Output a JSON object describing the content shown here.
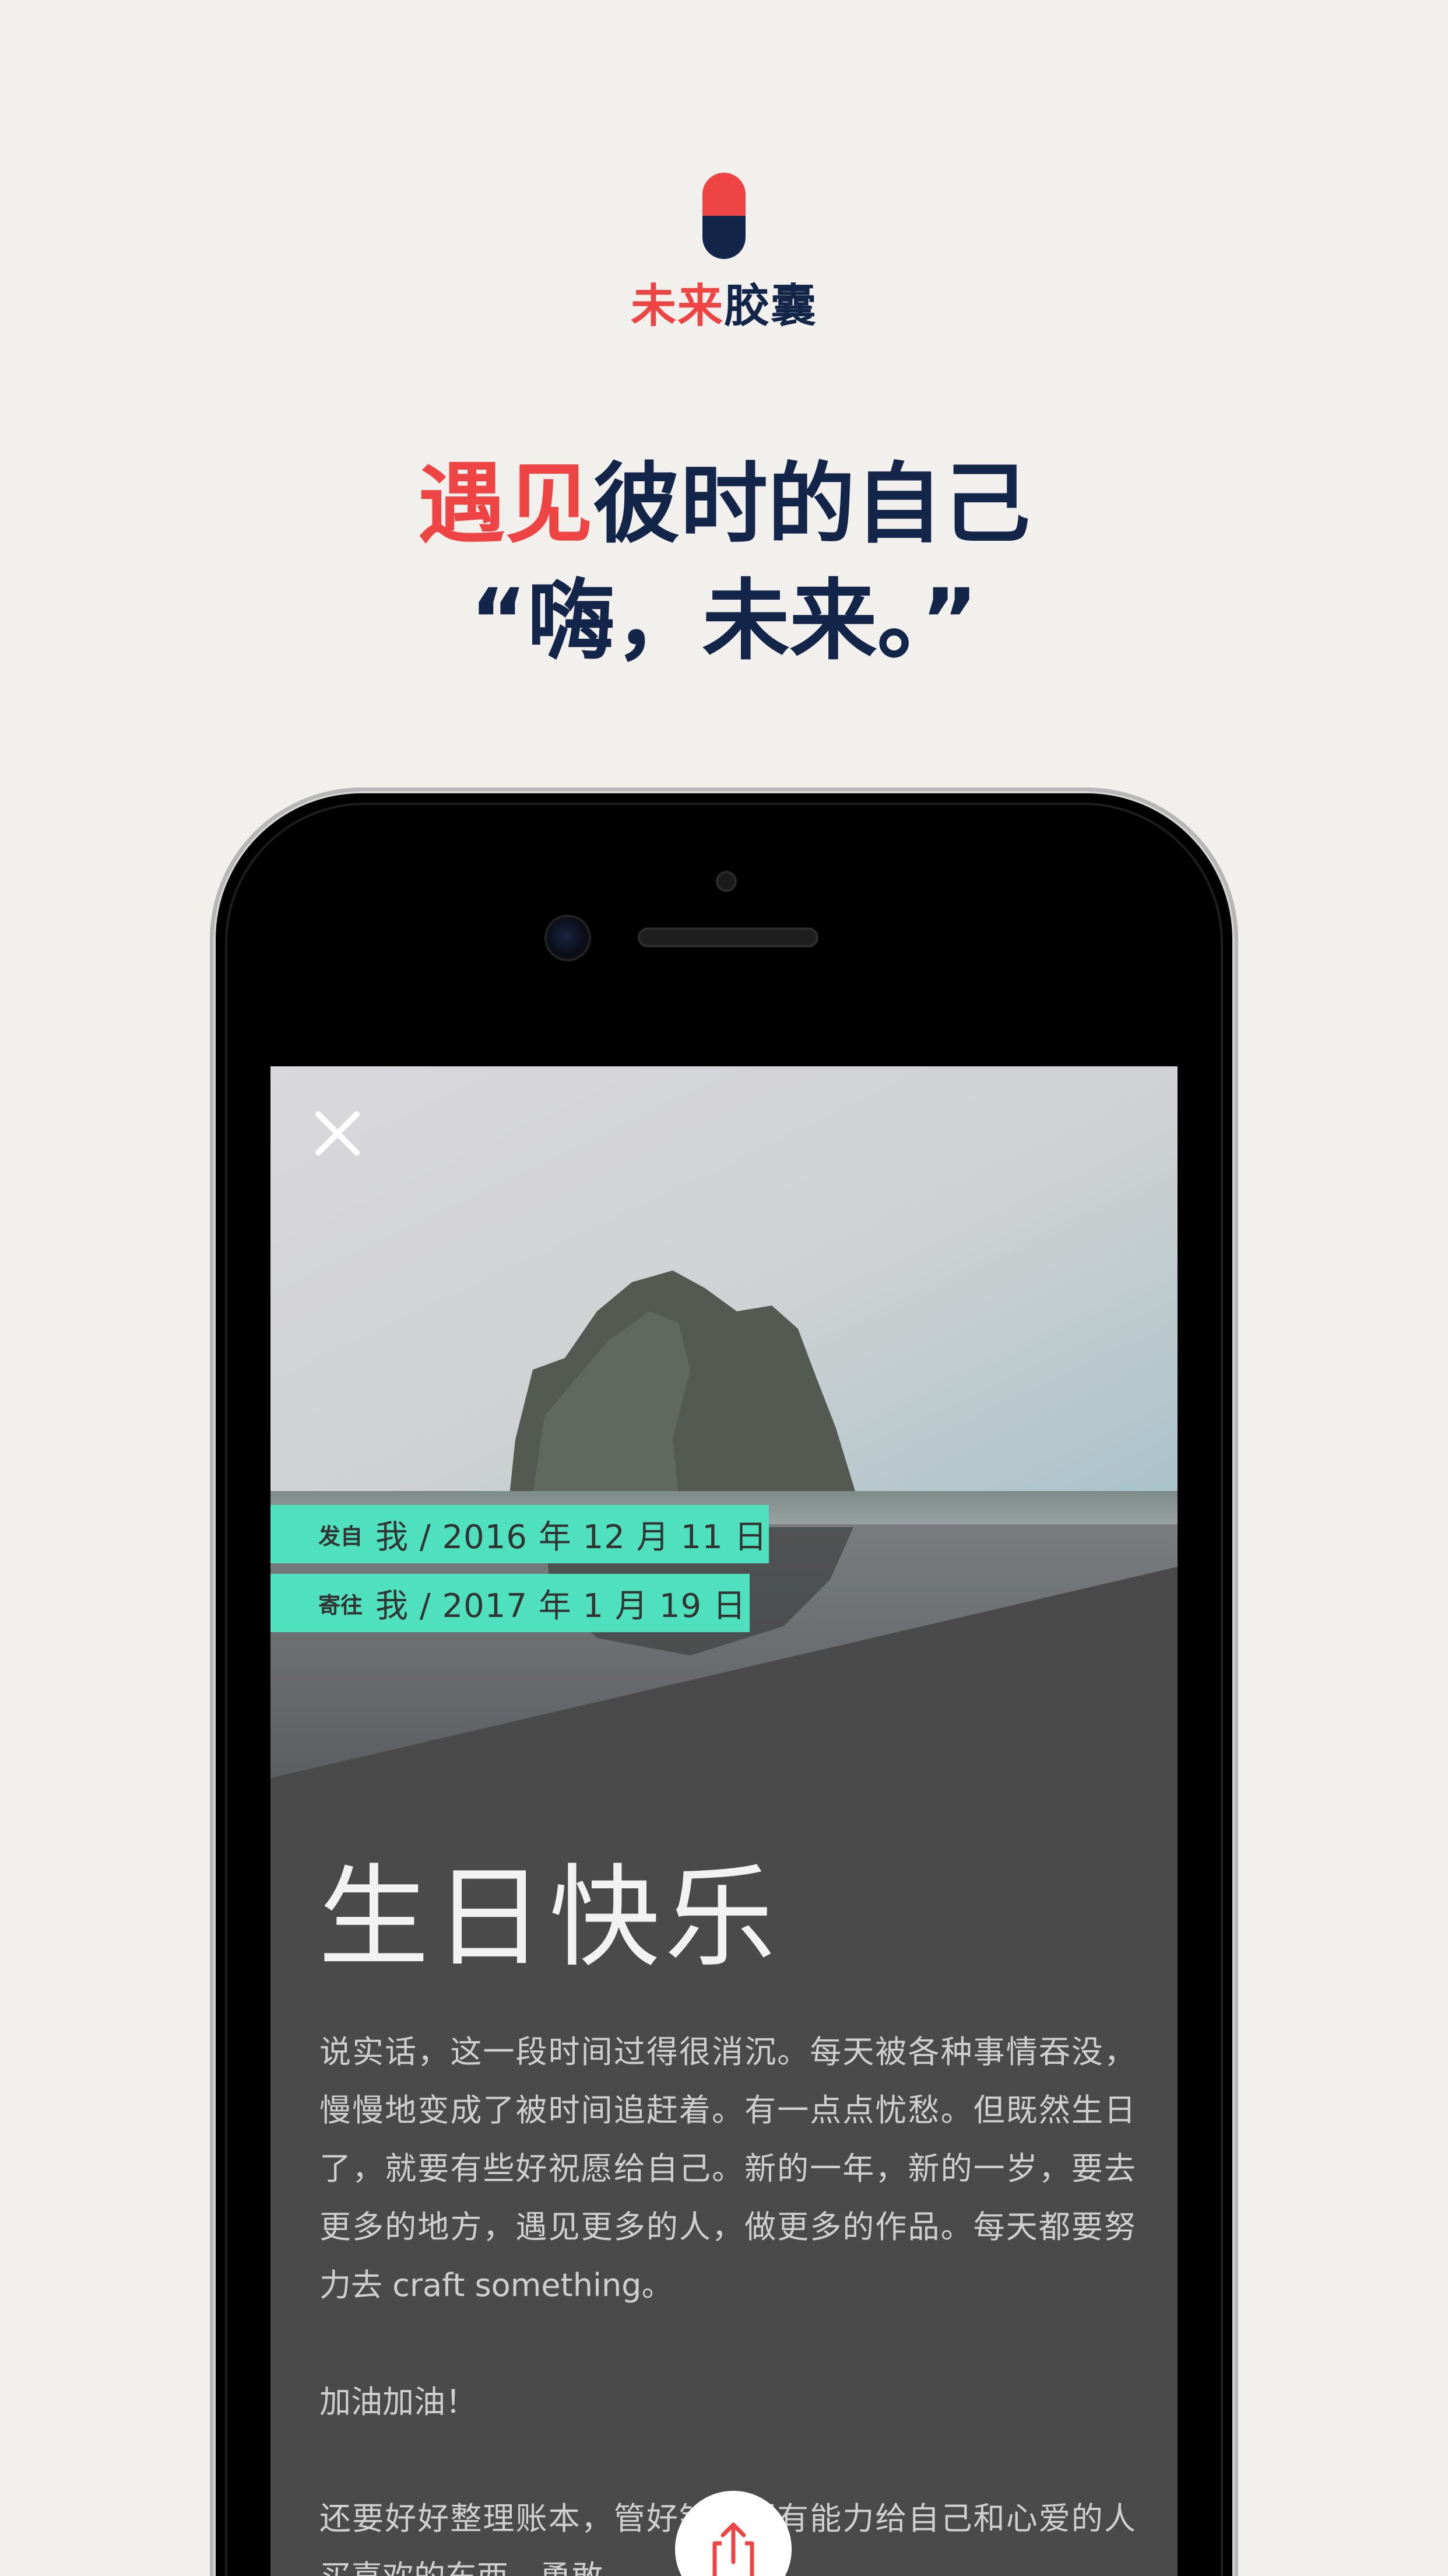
{
  "brand": {
    "name_red": "未来",
    "name_navy": "胶囊",
    "colors": {
      "red": "#ef4444",
      "navy": "#132548",
      "accent": "#4fe0bd"
    }
  },
  "headline": {
    "line1_red": "遇见",
    "line1_rest": "彼时的自己",
    "line2": "“嗨，未来。”"
  },
  "capsule": {
    "from_label": "发自",
    "from_value": "我 / 2016 年 12 月 11 日",
    "to_label": "寄往",
    "to_value": "我 / 2017 年 1 月 19 日",
    "title": "生日快乐",
    "paragraphs": [
      "说实话，这一段时间过得很消沉。每天被各种事情吞没，慢慢地变成了被时间追赶着。有一点点忧愁。但既然生日了，就要有些好祝愿给自己。新的一年，新的一岁，要去更多的地方，遇见更多的人，做更多的作品。每天都要努力去 craft something。",
      "加油加油！",
      "还要好好整理账本，管好钱，要有能力给自己和心爱的人买喜欢的东西，勇敢"
    ]
  },
  "icons": {
    "close": "close-icon",
    "share": "share-icon"
  }
}
